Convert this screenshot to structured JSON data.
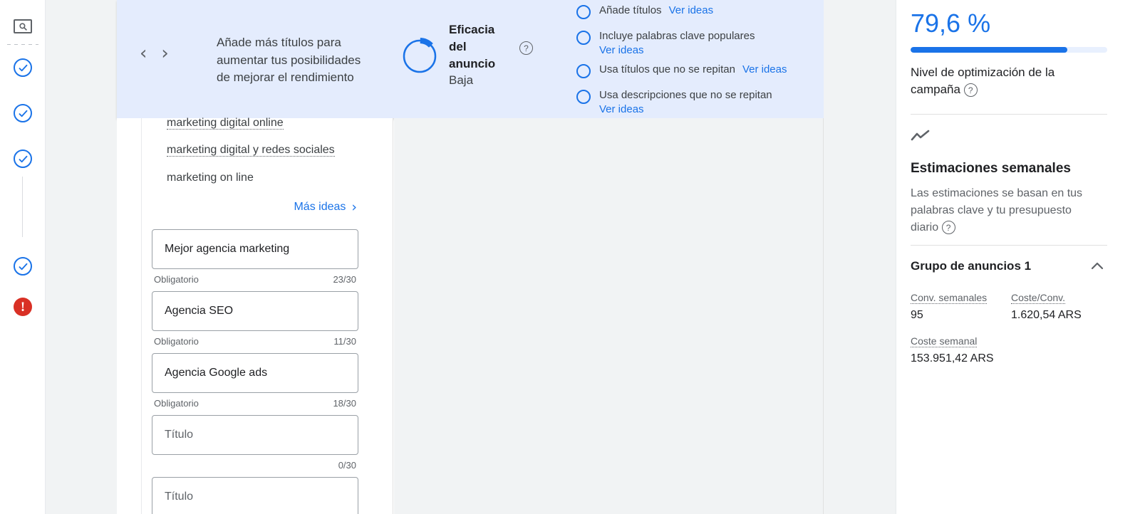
{
  "rail": {
    "items": [
      {
        "name": "search-ad-icon",
        "type": "search"
      },
      {
        "name": "step-complete-1",
        "type": "check"
      },
      {
        "name": "step-complete-2",
        "type": "check"
      },
      {
        "name": "step-complete-3",
        "type": "check"
      },
      {
        "name": "step-complete-4",
        "type": "check"
      },
      {
        "name": "step-error",
        "type": "error"
      }
    ]
  },
  "banner": {
    "prev_arrow": "‹",
    "next_arrow": "›",
    "message": "Añade más títulos para aumentar tus posibilidades de mejorar el rendimiento",
    "strength_title": "Eficacia del anuncio",
    "strength_value": "Baja",
    "help_icon": "?",
    "donut_percent": 12,
    "suggestions": [
      {
        "text": "Añade títulos",
        "link": "Ver ideas",
        "inline": true
      },
      {
        "text": "Incluye palabras clave populares",
        "link": "Ver ideas",
        "inline": false
      },
      {
        "text": "Usa títulos que no se repitan",
        "link": "Ver ideas",
        "inline": true
      },
      {
        "text": "Usa descripciones que no se repitan",
        "link": "Ver ideas",
        "inline": false
      }
    ]
  },
  "editor": {
    "keywords": [
      "marketing digital online",
      "marketing digital y redes sociales",
      "marketing on line"
    ],
    "more_ideas_label": "Más ideas",
    "more_ideas_chevron": "›",
    "headline_fields": [
      {
        "value": "Mejor agencia marketing",
        "placeholder": "Título",
        "required_label": "Obligatorio",
        "counter": "23/30",
        "empty": false
      },
      {
        "value": "Agencia SEO",
        "placeholder": "Título",
        "required_label": "Obligatorio",
        "counter": "11/30",
        "empty": false
      },
      {
        "value": "Agencia Google ads",
        "placeholder": "Título",
        "required_label": "Obligatorio",
        "counter": "18/30",
        "empty": false
      },
      {
        "value": "Título",
        "placeholder": "Título",
        "required_label": "",
        "counter": "0/30",
        "empty": true
      },
      {
        "value": "Título",
        "placeholder": "Título",
        "required_label": "",
        "counter": "",
        "empty": true
      }
    ]
  },
  "sidebar": {
    "optimization_percent": "79,6 %",
    "progress_value": 79.6,
    "optimization_label": "Nivel de optimización de la campaña",
    "help_icon": "?",
    "trend_icon": "trending-up-icon",
    "estimates_title": "Estimaciones semanales",
    "estimates_desc": "Las estimaciones se basan en tus palabras clave y tu presupuesto diario",
    "group_title": "Grupo de anuncios 1",
    "group_chevron": "collapse-chevron-up-icon",
    "stats": [
      {
        "label": "Conv. semanales",
        "value": "95"
      },
      {
        "label": "Coste/Conv.",
        "value": "1.620,54 ARS"
      },
      {
        "label": "Coste semanal",
        "value": "153.951,42 ARS"
      }
    ]
  },
  "colors": {
    "accent_blue": "#1a73e8",
    "banner_bg": "#e4ecfd",
    "error_red": "#d93025",
    "gutter_gray": "#f1f3f4"
  }
}
